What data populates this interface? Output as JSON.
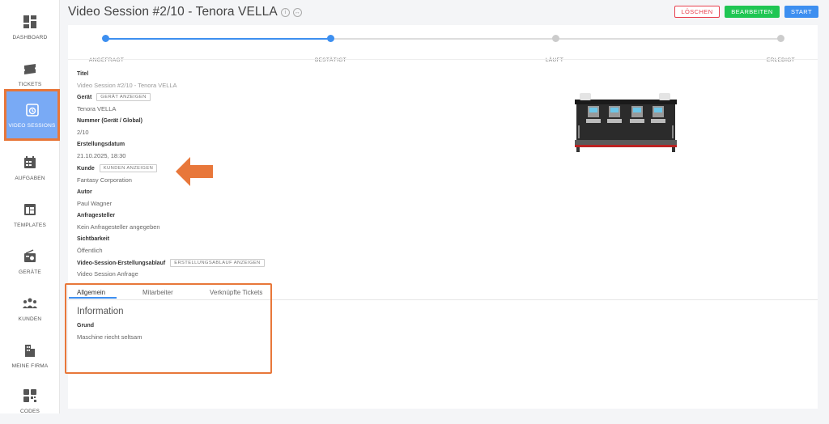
{
  "sidebar": {
    "items": [
      {
        "label": "DASHBOARD",
        "icon": "dashboard-icon"
      },
      {
        "label": "TICKETS",
        "icon": "ticket-icon"
      },
      {
        "label": "VIDEO SESSIONS",
        "icon": "video-session-icon",
        "active": true
      },
      {
        "label": "AUFGABEN",
        "icon": "calendar-icon"
      },
      {
        "label": "TEMPLATES",
        "icon": "template-icon"
      },
      {
        "label": "GERÄTE",
        "icon": "radio-device-icon"
      },
      {
        "label": "KUNDEN",
        "icon": "people-icon"
      },
      {
        "label": "MEINE FIRMA",
        "icon": "building-icon"
      },
      {
        "label": "CODES",
        "icon": "qr-code-icon"
      }
    ]
  },
  "header": {
    "title": "Video Session #2/10 - Tenora VELLA",
    "delete_label": "LÖSCHEN",
    "edit_label": "BEARBEITEN",
    "start_label": "START"
  },
  "progress": {
    "steps": [
      "ANGEFRAGT",
      "BESTÄTIGT",
      "LÄUFT",
      "ERLEDIGT"
    ],
    "completed_steps": 2
  },
  "details": {
    "titel_label": "Titel",
    "titel_value": "Video Session #2/10 - Tenora VELLA",
    "geraet_label": "Gerät",
    "geraet_button": "GERÄT ANZEIGEN",
    "geraet_value": "Tenora VELLA",
    "nummer_label": "Nummer (Gerät / Global)",
    "nummer_value": "2/10",
    "datum_label": "Erstellungsdatum",
    "datum_value": "21.10.2025, 18:30",
    "kunde_label": "Kunde",
    "kunde_button": "KUNDEN ANZEIGEN",
    "kunde_value": "Fantasy Corporation",
    "autor_label": "Autor",
    "autor_value": "Paul Wagner",
    "anfragesteller_label": "Anfragesteller",
    "anfragesteller_value": "Kein Anfragesteller angegeben",
    "sichtbarkeit_label": "Sichtbarkeit",
    "sichtbarkeit_value": "Öffentlich",
    "ablauf_label": "Video-Session-Erstellungsablauf",
    "ablauf_button": "ERSTELLUNGSABLAUF ANZEIGEN",
    "ablauf_value": "Video Session Anfrage"
  },
  "tabs": [
    {
      "label": "Allgemein",
      "active": true
    },
    {
      "label": "Mitarbeiter"
    },
    {
      "label": "Verknüpfte Tickets"
    }
  ],
  "information": {
    "title": "Information",
    "grund_label": "Grund",
    "grund_value": "Maschine riecht seltsam"
  },
  "colors": {
    "accent": "#3d8ff0",
    "annotation": "#e8773a",
    "delete": "#e8404e",
    "edit": "#1fc653"
  }
}
